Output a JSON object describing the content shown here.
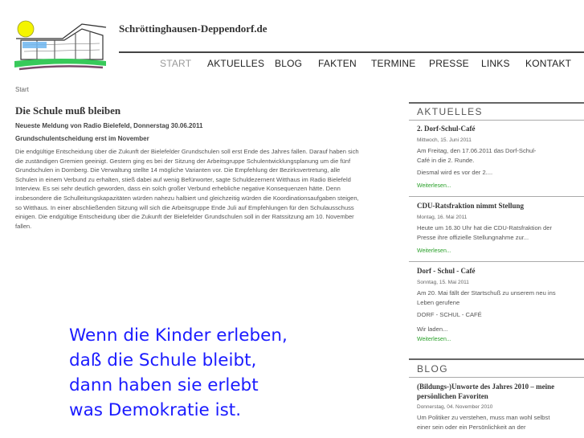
{
  "site": {
    "title": "Schröttinghausen-Deppendorf.de"
  },
  "nav": {
    "items": [
      "START",
      "AKTUELLES",
      "BLOG",
      "FAKTEN",
      "TERMINE",
      "PRESSE",
      "LINKS",
      "KONTAKT"
    ],
    "active": "START"
  },
  "breadcrumb": "Start",
  "article": {
    "title": "Die Schule muß bleiben",
    "subtitle1": "Neueste Meldung von Radio Bielefeld, Donnerstag 30.06.2011",
    "subtitle2": "Grundschulentscheidung erst im November",
    "lines": [
      "Die endgültige Entscheidung über die Zukunft der Bielefelder Grundschulen soll erst Ende des Jahres fallen. Darauf haben sich",
      "die zuständigen Gremien geeinigt. Gestern ging es bei der Sitzung der Arbeitsgruppe Schulentwicklungsplanung um die fünf",
      "Grundschulen in Dornberg. Die Verwaltung stellte 14 mögliche Varianten vor. Die Empfehlung der Bezirksvertretung, alle",
      "Schulen in einem Verbund zu erhalten, stieß dabei auf wenig Befürworter, sagte Schuldezernent Witthaus im Radio Bielefeld",
      "Interview. Es sei sehr deutlich geworden, dass ein solch großer Verbund erhebliche negative Konsequenzen hätte. Denn",
      "insbesondere die Schulleitungskapazitäten würden nahezu halbiert und gleichzeitig würden die Koordinationsaufgaben steigen,",
      "so Witthaus. In einer abschließenden Sitzung will sich die Arbeitsgruppe Ende Juli auf Empfehlungen für den Schulausschuss",
      "einigen. Die endgültige Entscheidung über die Zukunft der Bielefelder Grundschulen soll in der Ratssitzung am 10. November",
      "fallen."
    ],
    "quote_lines": [
      "Wenn die Kinder erleben,",
      "daß die Schule bleibt,",
      "dann haben sie erlebt",
      "was Demokratie ist."
    ]
  },
  "sidebar": {
    "aktuelles_heading": "AKTUELLES",
    "posts": [
      {
        "title": "2. Dorf-Schul-Café",
        "date": "Mittwoch, 15. Juni 2011",
        "lines": [
          "Am Freitag, den 17.06.2011 das Dorf-Schul-",
          "Café in die 2. Runde."
        ],
        "extra": "Diesmal wird es vor der 2....",
        "link": "Weiterlesen..."
      },
      {
        "title": "CDU-Ratsfraktion nimmt Stellung",
        "date": "Montag, 16. Mai 2011",
        "lines": [
          "Heute um 16.30 Uhr hat die CDU-Ratsfraktion der",
          "Presse ihre offizielle Stellungnahme zur..."
        ],
        "extra": "",
        "link": "Weiterlesen..."
      },
      {
        "title": "Dorf - Schul - Café",
        "date": "Sonntag, 15. Mai 2011",
        "lines": [
          "Am 20. Mai fällt der Startschuß zu unserem neu ins",
          "Leben gerufene"
        ],
        "extra_lines": [
          "DORF - SCHUL - CAFÉ",
          "Wir laden..."
        ],
        "link": "Weiterlesen..."
      }
    ],
    "blog_heading": "BLOG",
    "blog_post": {
      "title_lines": [
        "(Bildungs-)Unworte des Jahres 2010 – meine",
        "persönlichen Favoriten"
      ],
      "date": "Donnerstag, 04. November 2010",
      "lines": [
        "Um Politiker zu verstehen, muss man wohl selbst",
        "einer sein oder ein Persönlichkeit an der"
      ]
    }
  },
  "colors": {
    "quote": "#1b1bff",
    "link": "#2aa02a",
    "nav_active": "#9a9a9a"
  }
}
